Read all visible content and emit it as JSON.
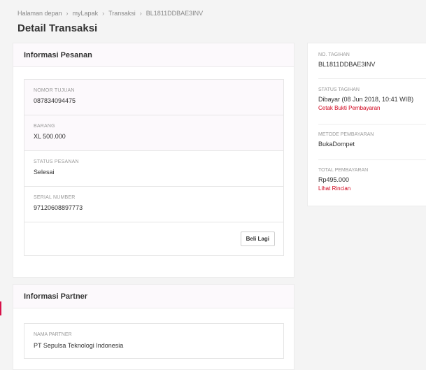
{
  "breadcrumb": [
    "Halaman depan",
    "myLapak",
    "Transaksi",
    "BL1811DDBAE3INV"
  ],
  "page_title": "Detail Transaksi",
  "order": {
    "title": "Informasi Pesanan",
    "rows": [
      {
        "label": "NOMOR TUJUAN",
        "value": "087834094475"
      },
      {
        "label": "BARANG",
        "value": "XL 500.000"
      },
      {
        "label": "STATUS PESANAN",
        "value": "Selesai"
      },
      {
        "label": "SERIAL NUMBER",
        "value": "97120608897773"
      }
    ],
    "buy_again_label": "Beli Lagi"
  },
  "partner": {
    "title": "Informasi Partner",
    "label": "NAMA PARTNER",
    "value": "PT Sepulsa Teknologi Indonesia"
  },
  "summary": {
    "invoice_label": "NO. TAGIHAN",
    "invoice_value": "BL1811DDBAE3INV",
    "status_label": "STATUS TAGIHAN",
    "status_value": "Dibayar (08 Jun 2018, 10:41 WIB)",
    "print_link": "Cetak Bukti Pembayaran",
    "method_label": "METODE PEMBAYARAN",
    "method_value": "BukaDompet",
    "total_label": "TOTAL PEMBAYARAN",
    "total_value": "Rp495.000",
    "detail_link": "Lihat Rincian"
  },
  "colors": {
    "accent": "#d0021b",
    "marker": "#d71149"
  }
}
